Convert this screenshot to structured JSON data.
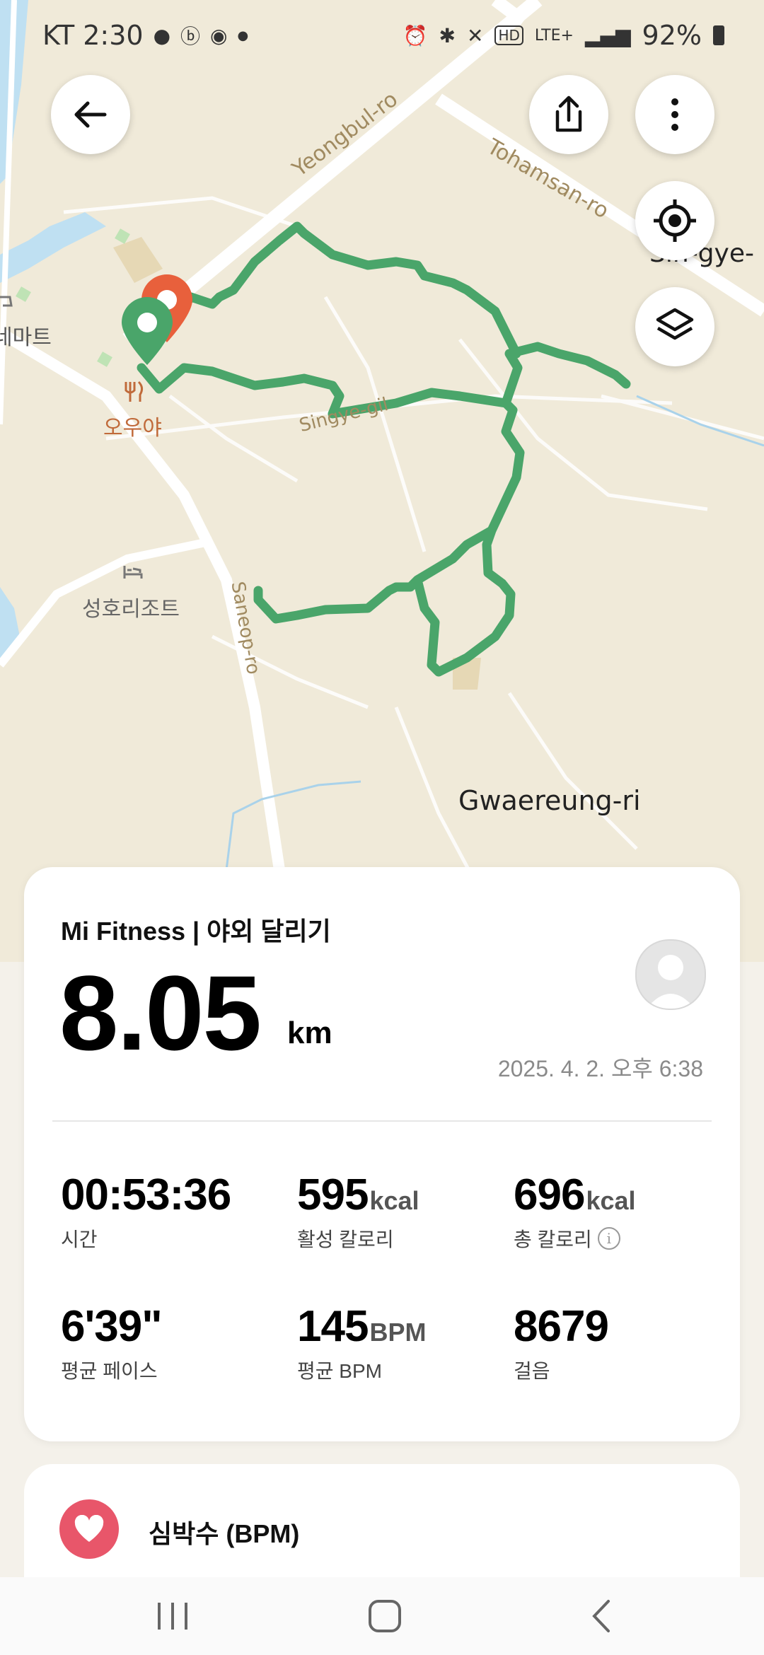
{
  "status_bar": {
    "carrier_time": "KT 2:30",
    "battery": "92%",
    "network": "LTE+"
  },
  "map": {
    "labels": {
      "road1": "Yeongbul-ro",
      "road2": "Tohamsan-ro",
      "road3": "Singye-gil",
      "road4": "Saneop-ro",
      "place1": "오우야",
      "place2": "성호리조트",
      "place3": "Gwaereung-ri",
      "place4": "Sin-gye-",
      "place5": "네마트"
    }
  },
  "workout": {
    "source": "Mi Fitness | 야외 달리기",
    "distance": "8.05",
    "distance_unit": "km",
    "datetime": "2025. 4. 2. 오후 6:38",
    "stats": [
      {
        "value": "00:53:36",
        "unit": "",
        "label": "시간"
      },
      {
        "value": "595",
        "unit": "kcal",
        "label": "활성 칼로리"
      },
      {
        "value": "696",
        "unit": "kcal",
        "label": "총 칼로리"
      },
      {
        "value": "6'39\"",
        "unit": "",
        "label": "평균 페이스"
      },
      {
        "value": "145",
        "unit": "BPM",
        "label": "평균 BPM"
      },
      {
        "value": "8679",
        "unit": "",
        "label": "걸음"
      }
    ]
  },
  "heart_section": {
    "title": "심박수 (BPM)"
  },
  "colors": {
    "route": "#4aa56a",
    "start_pin": "#4aa56a",
    "end_pin": "#e8603c",
    "heart": "#e8566a"
  }
}
